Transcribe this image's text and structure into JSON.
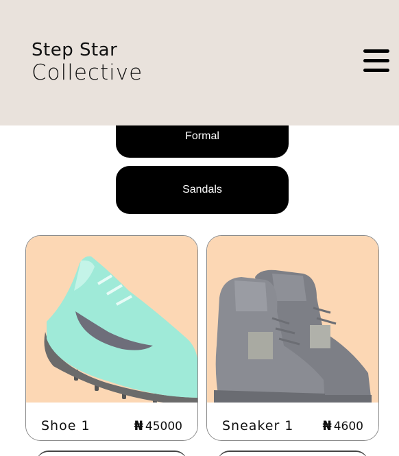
{
  "header": {
    "brand_line1": "Step Star",
    "brand_line2": "Collective"
  },
  "categories": [
    {
      "label": "Formal"
    },
    {
      "label": "Sandals"
    }
  ],
  "products": [
    {
      "name": "Shoe 1",
      "currency": "₦",
      "price": "45000",
      "image": "mint-golf-shoe"
    },
    {
      "name": "Sneaker 1",
      "currency": "₦",
      "price": "4600",
      "image": "grey-high-top-sneakers"
    }
  ],
  "colors": {
    "header_bg": "#e9e2dc",
    "card_image_bg": "#fcd7b4",
    "button_bg": "#000000"
  }
}
